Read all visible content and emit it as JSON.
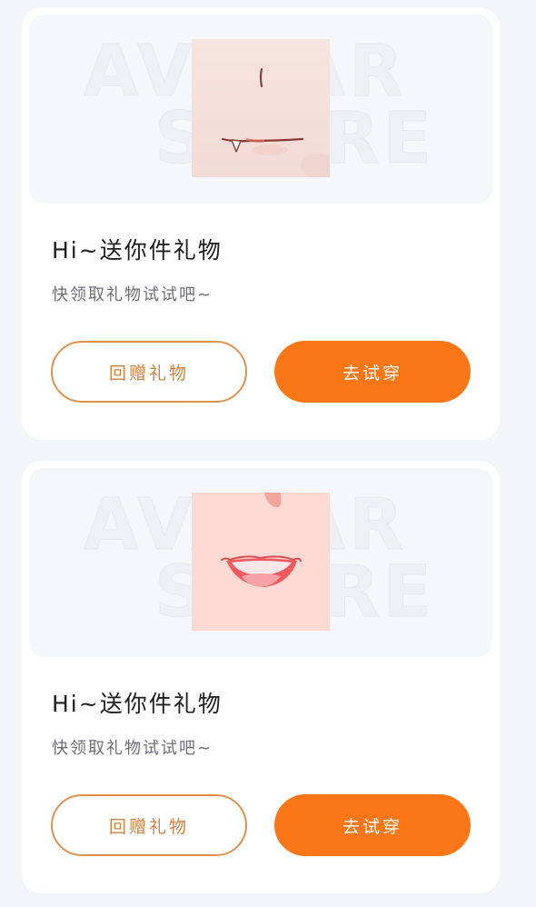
{
  "cards": [
    {
      "watermark": [
        "AVATAR",
        "STORE"
      ],
      "item": "mouth-fang-smile",
      "title": "Hi~送你件礼物",
      "subtitle": "快领取礼物试试吧~",
      "gift_button": "回赠礼物",
      "try_button": "去试穿"
    },
    {
      "watermark": [
        "AVATAR",
        "STORE"
      ],
      "item": "mouth-open-smile",
      "title": "Hi~送你件礼物",
      "subtitle": "快领取礼物试试吧~",
      "gift_button": "回赠礼物",
      "try_button": "去试穿"
    }
  ],
  "colors": {
    "accent": "#fa7617",
    "outline_button": "#df9250",
    "background": "#f4f5f8"
  }
}
